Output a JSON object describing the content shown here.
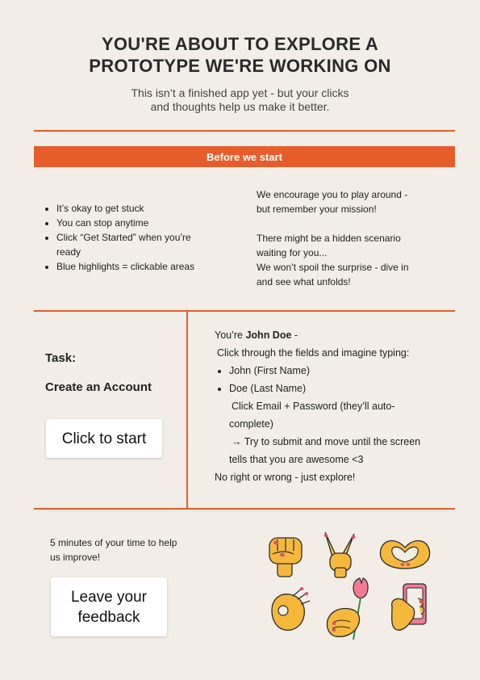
{
  "header": {
    "title_line1": "YOU'RE ABOUT TO EXPLORE A",
    "title_line2": "PROTOTYPE WE'RE WORKING ON",
    "subtitle_line1": "This isn’t a finished app yet - but your clicks",
    "subtitle_line2": "and thoughts help us make it better."
  },
  "before_start": {
    "banner": "Before we start",
    "bullets": [
      "It’s okay to get stuck",
      "You can stop anytime",
      "Click “Get Started” when you’re ready",
      "Blue highlights = clickable areas"
    ],
    "right_text": {
      "line1": "We encourage you to play around -",
      "line2": "but remember your mission!",
      "line3": "There might be a hidden scenario",
      "line4": "waiting for you...",
      "line5": "We won’t spoil the surprise - dive in",
      "line6": "and see what unfolds!"
    }
  },
  "task": {
    "label": "Task:",
    "name": "Create an Account",
    "start_button": "Click to start",
    "intro_prefix": "You’re ",
    "intro_name": "John Doe",
    "intro_suffix": " -",
    "instruction": "Click through the fields and imagine typing:",
    "fields": [
      "John (First Name)",
      "Doe (Last Name)"
    ],
    "email_line1": "Click Email + Password (they’ll auto-",
    "email_line2": "complete)",
    "submit_line1": "→ Try to submit and move until the screen",
    "submit_line2": "tells that you are awesome <3",
    "footer": "No right or wrong - just explore!"
  },
  "feedback": {
    "text_line1": "5 minutes of your time to help",
    "text_line2": "us improve!",
    "button_line1": "Leave your",
    "button_line2": "feedback"
  },
  "colors": {
    "accent": "#e65c2a",
    "background": "#f2eee7",
    "skin": "#f5b83d",
    "nail": "#e0506b"
  },
  "illustrations": [
    "fist-hand-icon",
    "peace-sign-hand-icon",
    "heart-hands-icon",
    "ok-sign-hand-icon",
    "hand-holding-tulip-icon",
    "hand-holding-phone-icon"
  ]
}
